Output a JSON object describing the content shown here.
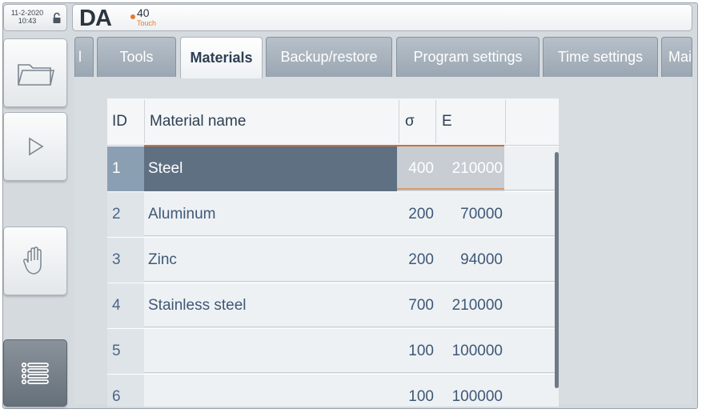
{
  "status": {
    "date": "11-2-2020",
    "time": "10:43"
  },
  "logo": {
    "brand": "DA",
    "model": "40",
    "edition": "Touch"
  },
  "tabs": [
    {
      "label": "l"
    },
    {
      "label": "Tools"
    },
    {
      "label": "Materials"
    },
    {
      "label": "Backup/restore"
    },
    {
      "label": "Program settings"
    },
    {
      "label": "Time settings"
    },
    {
      "label": "Mai"
    }
  ],
  "table": {
    "headers": {
      "id": "ID",
      "name": "Material name",
      "sigma": "σ",
      "e": "E"
    },
    "rows": [
      {
        "id": "1",
        "name": "Steel",
        "sigma": "400",
        "e": "210000"
      },
      {
        "id": "2",
        "name": "Aluminum",
        "sigma": "200",
        "e": "70000"
      },
      {
        "id": "3",
        "name": "Zinc",
        "sigma": "200",
        "e": "94000"
      },
      {
        "id": "4",
        "name": "Stainless steel",
        "sigma": "700",
        "e": "210000"
      },
      {
        "id": "5",
        "name": "",
        "sigma": "100",
        "e": "100000"
      },
      {
        "id": "6",
        "name": "",
        "sigma": "100",
        "e": "100000"
      }
    ]
  },
  "sidebar": {
    "icons": [
      "folder-icon",
      "play-icon",
      "hand-icon",
      "list-menu-icon"
    ]
  },
  "colors": {
    "accent": "#e8792a",
    "selected_row": "#5f7083",
    "tab_inactive": "#a3afbb"
  }
}
